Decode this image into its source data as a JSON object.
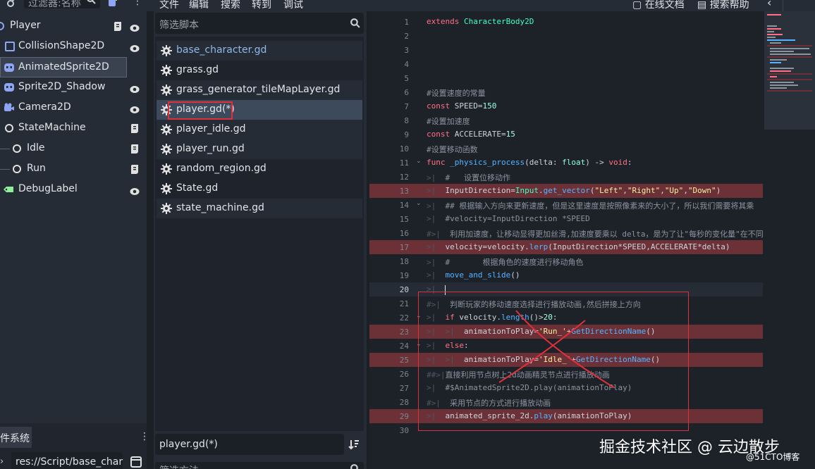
{
  "topbar": {
    "filter_text": "过滤器:名称",
    "menu": [
      "文件",
      "编辑",
      "搜索",
      "转到",
      "调试"
    ],
    "online_docs": "在线文档",
    "search_help": "搜索帮助"
  },
  "scene_tree": {
    "nodes": [
      {
        "label": "Player",
        "icon": "node2d-icon"
      },
      {
        "label": "CollisionShape2D",
        "icon": "collision-shape-icon"
      },
      {
        "label": "AnimatedSprite2D",
        "icon": "animated-sprite-icon"
      },
      {
        "label": "Sprite2D_Shadow",
        "icon": "sprite-icon"
      },
      {
        "label": "Camera2D",
        "icon": "camera-icon"
      },
      {
        "label": "StateMachine",
        "icon": "node-icon"
      },
      {
        "label": "Idle",
        "icon": "node-icon"
      },
      {
        "label": "Run",
        "icon": "node-icon"
      },
      {
        "label": "DebugLabel",
        "icon": "label-icon"
      }
    ]
  },
  "filesystem": {
    "tab_label": "文件系统",
    "path": "res://Script/base_char"
  },
  "scripts": {
    "filter_placeholder": "筛选脚本",
    "items": [
      "base_character.gd",
      "grass.gd",
      "grass_generator_tileMapLayer.gd",
      "player.gd(*)",
      "player_idle.gd",
      "player_run.gd",
      "random_region.gd",
      "State.gd",
      "state_machine.gd"
    ],
    "current": "player.gd(*)",
    "method_filter": "筛选方法"
  },
  "editor": {
    "lines": [
      "1",
      "2",
      "3",
      "4",
      "5",
      "6",
      "7",
      "8",
      "9",
      "10",
      "11",
      "12",
      "13",
      "14",
      "15",
      "16",
      "17",
      "18",
      "19",
      "20",
      "21",
      "22",
      "23",
      "24",
      "25",
      "26",
      "27",
      "28",
      "29",
      "30"
    ],
    "code": {
      "l1a": "extends ",
      "l1b": "CharacterBody2D",
      "l6": "#设置速度的常量",
      "l7a": "const",
      "l7b": " SPEED=",
      "l7c": "150",
      "l8": "#设置加速度",
      "l9a": "const",
      "l9b": " ACCELERATE=",
      "l9c": "15",
      "l10": "#设置移动函数",
      "l11a": "func",
      "l11b": " _physics_process",
      "l11c": "(delta: ",
      "l11d": "float",
      "l11e": ") -> ",
      "l11f": "void",
      "l11g": ":",
      "l12": "#   设置位移动作",
      "l13a": "InputDirection=",
      "l13b": "Input",
      "l13c": ".",
      "l13d": "get_vector",
      "l13e": "(",
      "l13f": "\"Left\"",
      "l13g": ",",
      "l13h": "\"Right\"",
      "l13i": ",",
      "l13j": "\"Up\"",
      "l13k": ",",
      "l13l": "\"Down\"",
      "l13m": ")",
      "l14": "## 根据输入方向来更新速度，但是这里速度是按照像素来的大小了，所以我们需要将其乘",
      "l15": "#velocity=InputDirection *SPEED",
      "l16": "利用加速度，让移动显得更加丝滑,加速度要乘以 delta，是为了让\"每秒的变化量\"在不同",
      "l17a": "velocity=velocity.",
      "l17b": "lerp",
      "l17c": "(InputDirection*SPEED,ACCELERATE*delta)",
      "l18": "#       根据角色的速度进行移动角色",
      "l19a": "move_and_slide",
      "l19b": "()",
      "l21": "判断玩家的移动速度选择进行播放动画,然后拼接上方向",
      "l22a": "if",
      "l22b": " velocity.",
      "l22c": "length",
      "l22d": "()>",
      "l22e": "20",
      "l22f": ":",
      "l23a": "animationToPlay=",
      "l23b": "'Run_'",
      "l23c": "+",
      "l23d": "GetDirectionName",
      "l23e": "()",
      "l24a": "else",
      "l24b": ":",
      "l25a": "animationToPlay=",
      "l25b": "'Idle_'",
      "l25c": "+",
      "l25d": "GetDirectionName",
      "l25e": "()",
      "l26": "直接利用节点树上2d动画精灵节点进行播放动画",
      "l27": "#$AnimatedSprite2D.play(animationToPlay)",
      "l28": "采用节点的方式进行播放动画",
      "l29a": "animated_sprite_2d.",
      "l29b": "play",
      "l29c": "(animationToPlay)"
    }
  },
  "watermark": "掘金技术社区 @ 云边散步",
  "watermark2": "@51CTO博客",
  "colors": {
    "error_line": "#6b3137",
    "annotation": "#e0303a",
    "keyword": "#ff7085",
    "function": "#57b3ff",
    "string": "#ffeda1"
  }
}
